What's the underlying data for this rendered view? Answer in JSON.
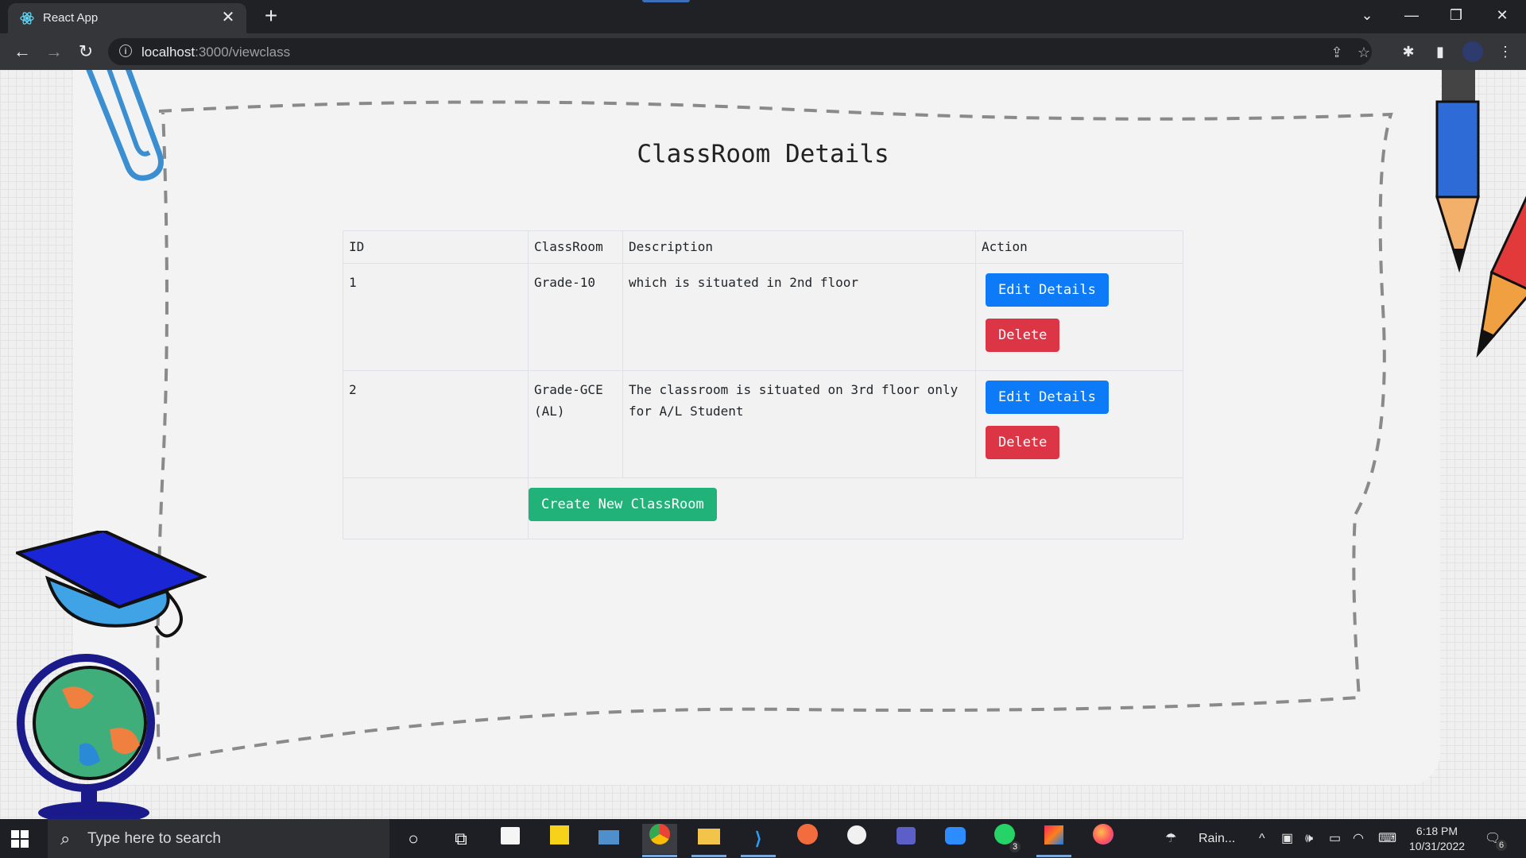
{
  "browser": {
    "tab_title": "React App",
    "url_host": "localhost",
    "url_path": ":3000/viewclass"
  },
  "page": {
    "title": "ClassRoom Details",
    "table": {
      "headers": [
        "ID",
        "ClassRoom",
        "Description",
        "Action"
      ],
      "rows": [
        {
          "id": "1",
          "classroom": "Grade-10",
          "description": "which is situated in 2nd floor"
        },
        {
          "id": "2",
          "classroom": "Grade-GCE(AL)",
          "description": "The classroom is situated on 3rd floor only for A/L Student"
        }
      ]
    },
    "edit_label": "Edit Details",
    "delete_label": "Delete",
    "create_label": "Create New ClassRoom"
  },
  "taskbar": {
    "search_placeholder": "Type here to search",
    "weather": "Rain...",
    "time": "6:18 PM",
    "date": "10/31/2022",
    "whatsapp_badge": "3",
    "notifications_badge": "6",
    "apps": [
      "cortana-icon",
      "task-view-icon",
      "store-icon",
      "sticky-notes-icon",
      "terminal-icon",
      "chrome-icon",
      "file-explorer-icon",
      "vscode-icon",
      "postman-icon",
      "mongodb-icon",
      "teams-icon",
      "zoom-icon",
      "whatsapp-icon",
      "intellij-icon",
      "firefox-icon"
    ]
  },
  "colors": {
    "edit": "#0d7bf7",
    "delete": "#dc3545",
    "create": "#21b27a"
  }
}
